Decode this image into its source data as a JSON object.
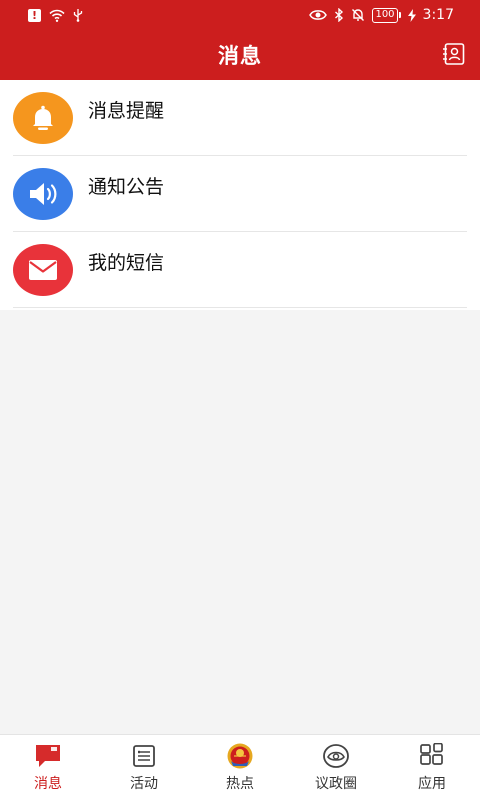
{
  "status_bar": {
    "time": "3:17",
    "battery": "100"
  },
  "header": {
    "title": "消息"
  },
  "list": {
    "items": [
      {
        "label": "消息提醒",
        "icon": "bell-icon",
        "color": "#f5961e"
      },
      {
        "label": "通知公告",
        "icon": "speaker-icon",
        "color": "#3a7ee8"
      },
      {
        "label": "我的短信",
        "icon": "envelope-icon",
        "color": "#e8333a"
      }
    ]
  },
  "tabbar": {
    "items": [
      {
        "label": "消息",
        "icon": "message-icon",
        "active": true
      },
      {
        "label": "活动",
        "icon": "list-icon",
        "active": false
      },
      {
        "label": "热点",
        "icon": "emblem-icon",
        "active": false
      },
      {
        "label": "议政圈",
        "icon": "eye-circle-icon",
        "active": false
      },
      {
        "label": "应用",
        "icon": "apps-icon",
        "active": false
      }
    ]
  },
  "colors": {
    "brand": "#cc1e1e",
    "background": "#f4f4f4"
  }
}
